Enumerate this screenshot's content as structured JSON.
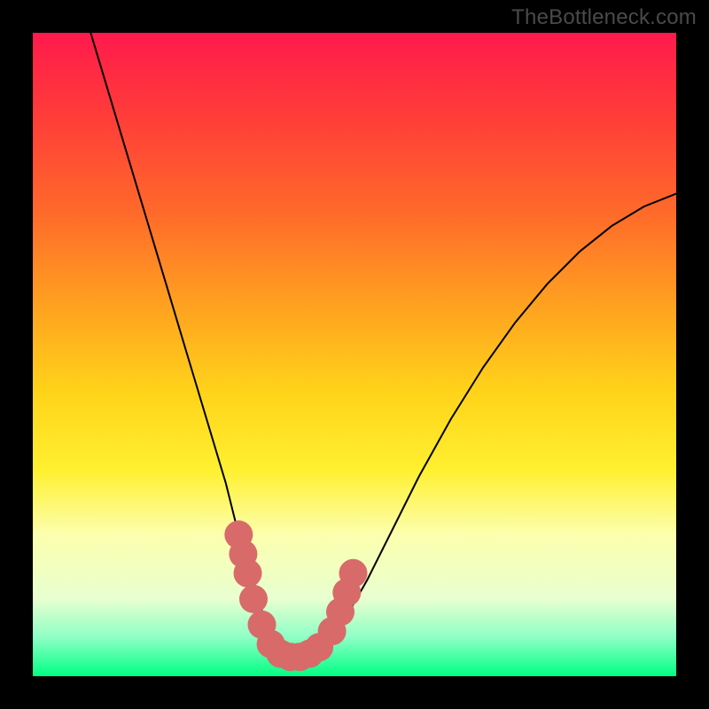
{
  "watermark": "TheBottleneck.com",
  "chart_data": {
    "type": "line",
    "title": "",
    "xlabel": "",
    "ylabel": "",
    "xlim": [
      0,
      100
    ],
    "ylim": [
      0,
      100
    ],
    "series": [
      {
        "name": "bottleneck-curve",
        "x": [
          9,
          12,
          15,
          18,
          21,
          24,
          27,
          30,
          32,
          34,
          36,
          37,
          38,
          39,
          40,
          42,
          44,
          46,
          48,
          52,
          56,
          60,
          65,
          70,
          75,
          80,
          85,
          90,
          95,
          100
        ],
        "values": [
          100,
          90,
          80,
          70,
          60,
          50,
          40,
          30,
          22,
          15,
          9,
          6,
          4,
          3,
          2.5,
          2.5,
          3,
          5,
          8,
          15,
          23,
          31,
          40,
          48,
          55,
          61,
          66,
          70,
          73,
          75
        ]
      }
    ],
    "markers": {
      "name": "highlighted-points",
      "color": "#d86a6a",
      "points": [
        {
          "x": 32.0,
          "y": 22,
          "r": 2.2
        },
        {
          "x": 32.7,
          "y": 19,
          "r": 2.2
        },
        {
          "x": 33.4,
          "y": 16,
          "r": 2.2
        },
        {
          "x": 34.3,
          "y": 12,
          "r": 2.2
        },
        {
          "x": 35.6,
          "y": 8,
          "r": 2.2
        },
        {
          "x": 37.0,
          "y": 5,
          "r": 2.2
        },
        {
          "x": 38.5,
          "y": 3.5,
          "r": 2.2
        },
        {
          "x": 40.0,
          "y": 3,
          "r": 2.2
        },
        {
          "x": 41.5,
          "y": 3,
          "r": 2.2
        },
        {
          "x": 43.0,
          "y": 3.5,
          "r": 2.2
        },
        {
          "x": 44.5,
          "y": 4.5,
          "r": 2.2
        },
        {
          "x": 46.5,
          "y": 7,
          "r": 2.2
        },
        {
          "x": 47.8,
          "y": 10,
          "r": 2.2
        },
        {
          "x": 48.8,
          "y": 13,
          "r": 2.2
        },
        {
          "x": 49.8,
          "y": 16,
          "r": 2.2
        }
      ]
    },
    "colors": {
      "curve": "#000000",
      "marker": "#d86a6a",
      "background_top": "#ff1a4d",
      "background_bottom": "#00ff83",
      "frame": "#000000"
    }
  }
}
